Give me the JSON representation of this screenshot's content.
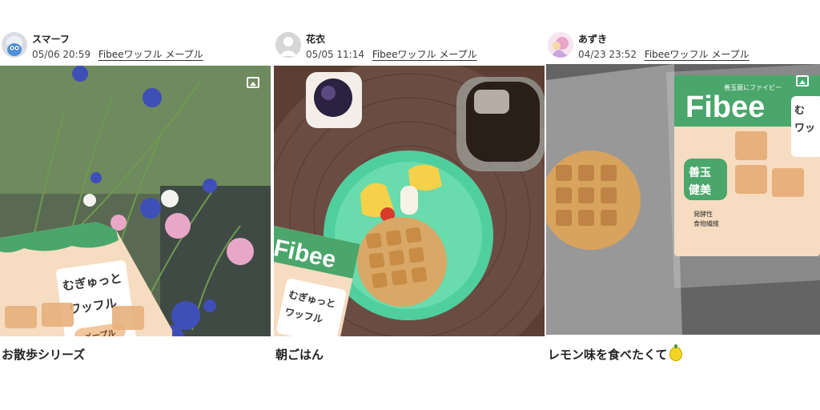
{
  "posts": [
    {
      "username": "スマーフ",
      "date": "05/06 20:59",
      "product": "Fibeeワッフル メープル",
      "caption": "お散歩シリーズ",
      "package_text": {
        "line1": "むぎゅっと",
        "line2": "ワッフル",
        "line3": "メープル"
      }
    },
    {
      "username": "花衣",
      "date": "05/05 11:14",
      "product": "Fibeeワッフル メープル",
      "caption": "朝ごはん",
      "package_text": {
        "brand": "Fibee",
        "line1": "むぎゅっと",
        "line2": "ワッフル"
      }
    },
    {
      "username": "あずき",
      "date": "04/23 23:52",
      "product": "Fibeeワッフル メープル",
      "caption": "レモン味を食べたくて",
      "package_text": {
        "brand": "Fibee",
        "sub": "善玉菌にファイビー",
        "line1": "む",
        "line2": "ワッ",
        "badge1": "善玉",
        "badge2": "健美",
        "fine1": "発酵性",
        "fine2": "食物繊維"
      }
    }
  ],
  "icons": {
    "gallery": "gallery-icon",
    "lemon": "lemon-emoji-icon"
  },
  "colors": {
    "text": "#222222",
    "meta": "#444444",
    "package_green": "#4aa66b",
    "package_peach": "#f6d9bd"
  }
}
